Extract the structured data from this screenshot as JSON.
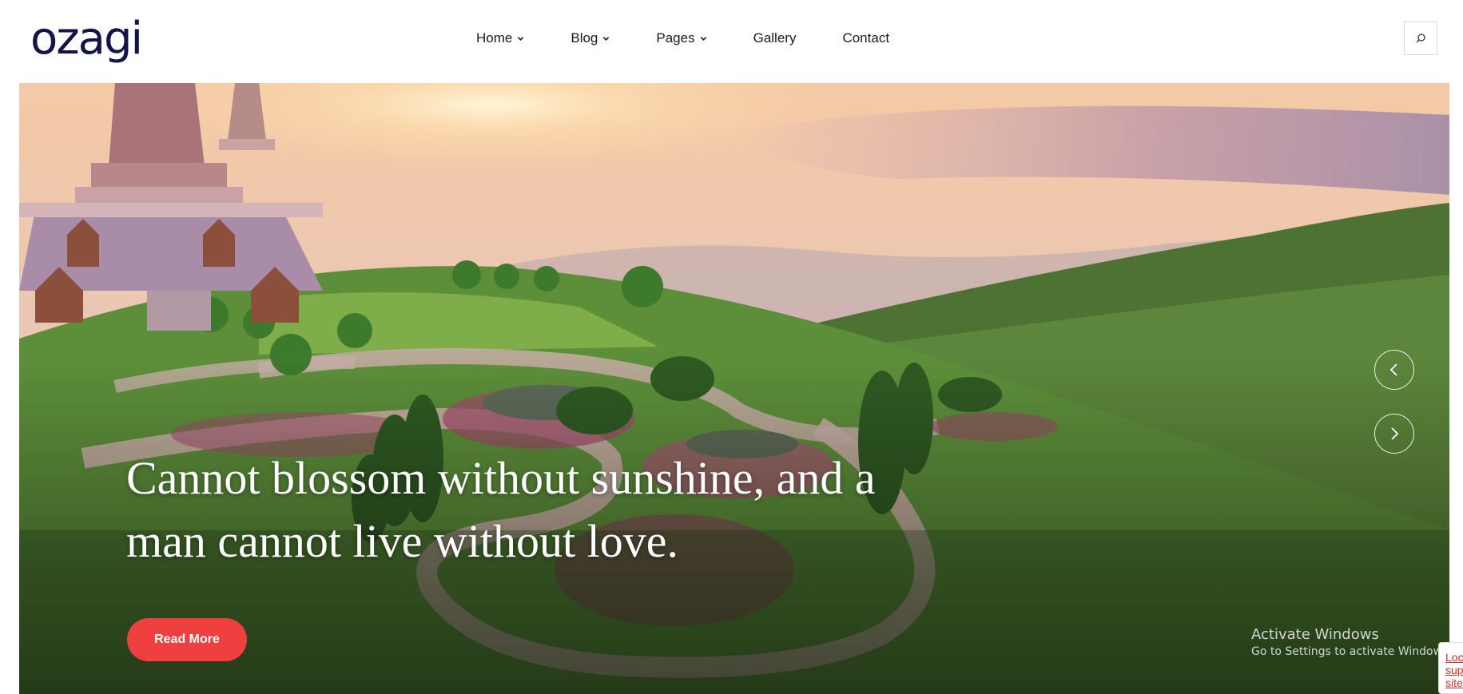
{
  "brand": {
    "logo_text": "ozagi",
    "logo_color": "#141447"
  },
  "nav": {
    "items": [
      {
        "label": "Home",
        "has_dropdown": true
      },
      {
        "label": "Blog",
        "has_dropdown": true
      },
      {
        "label": "Pages",
        "has_dropdown": true
      },
      {
        "label": "Gallery",
        "has_dropdown": false
      },
      {
        "label": "Contact",
        "has_dropdown": false
      }
    ],
    "search_icon": "search-icon"
  },
  "hero": {
    "headline_line1": "Cannot blossom without sunshine, and a",
    "headline_line2": "man cannot live without love.",
    "cta_label": "Read More",
    "cta_color": "#ef3f3f",
    "prev_icon": "chevron-left-icon",
    "next_icon": "chevron-right-icon"
  },
  "system_overlay": {
    "activate_title": "Activate Windows",
    "activate_sub": "Go to Settings to activate Windows."
  },
  "recaptcha_badge": {
    "line1": "Loc",
    "line2": "sup",
    "line3": "site"
  }
}
